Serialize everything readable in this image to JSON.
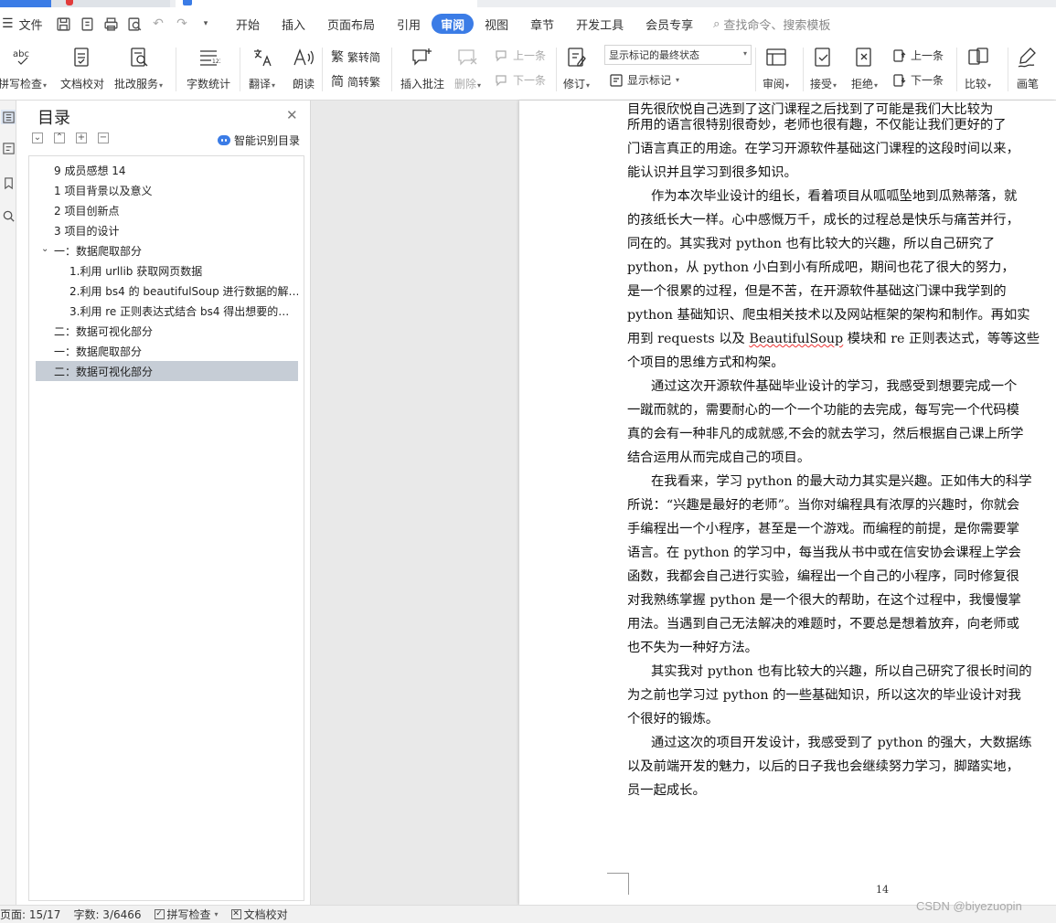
{
  "menu": {
    "file_label": "文件",
    "tabs": [
      "开始",
      "插入",
      "页面布局",
      "引用",
      "审阅",
      "视图",
      "章节",
      "开发工具",
      "会员专享"
    ],
    "active_tab": "审阅",
    "search_placeholder": "查找命令、搜索模板"
  },
  "ribbon": {
    "spell_check": "拼写检查",
    "doc_proofread": "文档校对",
    "revision_service": "批改服务",
    "word_count": "字数统计",
    "translate": "翻译",
    "read_aloud": "朗读",
    "trad_convert": "繁转简",
    "simp_convert": "简转繁",
    "insert_comment": "插入批注",
    "delete": "删除",
    "prev_comment": "上一条",
    "next_comment": "下一条",
    "track_changes": "修订",
    "markup_state": "显示标记的最终状态",
    "show_markup": "显示标记",
    "review_pane": "审阅",
    "accept": "接受",
    "reject": "拒绝",
    "prev_change": "上一条",
    "next_change": "下一条",
    "compare": "比较",
    "ink": "画笔"
  },
  "toc": {
    "title": "目录",
    "smart_label": "智能识别目录",
    "items": [
      {
        "text": "9   成员感想  14",
        "level": 1
      },
      {
        "text": "1   项目背景以及意义",
        "level": 1
      },
      {
        "text": "2   项目创新点",
        "level": 1
      },
      {
        "text": "3   项目的设计",
        "level": 1
      },
      {
        "text": "一：数据爬取部分",
        "level": 1,
        "expanded": true
      },
      {
        "text": "1.利用 urllib 获取网页数据",
        "level": 2
      },
      {
        "text": "2.利用 bs4 的 beautifulSoup 进行数据的解…",
        "level": 2
      },
      {
        "text": "3.利用 re 正则表达式结合 bs4 得出想要的…",
        "level": 2
      },
      {
        "text": "二：数据可视化部分",
        "level": 1
      },
      {
        "text": "一：数据爬取部分",
        "level": 1
      },
      {
        "text": "二：数据可视化部分",
        "level": 1,
        "selected": true
      }
    ]
  },
  "document": {
    "lines": [
      {
        "text": "目先很欣悦自己选到了这门课程之后找到了可能是我们大比较为",
        "indent": false,
        "first": true
      },
      {
        "text": "所用的语言很特别很奇妙，老师也很有趣，不仅能让我们更好的了",
        "indent": false
      },
      {
        "text": "门语言真正的用途。在学习开源软件基础这门课程的这段时间以来，",
        "indent": false
      },
      {
        "text": "能认识并且学习到很多知识。",
        "indent": false
      },
      {
        "text": "作为本次毕业设计的组长，看着项目从呱呱坠地到瓜熟蒂落，就",
        "indent": true
      },
      {
        "text": "的孩纸长大一样。心中感慨万千，成长的过程总是快乐与痛苦并行，",
        "indent": false
      },
      {
        "text": "同在的。其实我对 python 也有比较大的兴趣，所以自己研究了",
        "indent": false
      },
      {
        "text": "python，从 python 小白到小有所成吧，期间也花了很大的努力，",
        "indent": false
      },
      {
        "text": "是一个很累的过程，但是不苦，在开源软件基础这门课中我学到的",
        "indent": false
      },
      {
        "text": "python 基础知识、爬虫相关技术以及网站框架的架构和制作。再如实",
        "indent": false
      },
      {
        "text": "用到 requests 以及 BeautifulSoup 模块和 re 正则表达式，等等这些",
        "indent": false,
        "squiggle": "BeautifulSoup"
      },
      {
        "text": "个项目的思维方式和构架。",
        "indent": false
      },
      {
        "text": " 通过这次开源软件基础毕业设计的学习，我感受到想要完成一个",
        "indent": true
      },
      {
        "text": "一蹴而就的，需要耐心的一个一个功能的去完成，每写完一个代码模",
        "indent": false
      },
      {
        "text": "真的会有一种非凡的成就感,不会的就去学习，然后根据自己课上所学",
        "indent": false
      },
      {
        "text": "结合运用从而完成自己的项目。",
        "indent": false
      },
      {
        "text": "在我看来，学习 python 的最大动力其实是兴趣。正如伟大的科学",
        "indent": true
      },
      {
        "text": "所说：“兴趣是最好的老师”。当你对编程具有浓厚的兴趣时，你就会",
        "indent": false
      },
      {
        "text": "手编程出一个小程序，甚至是一个游戏。而编程的前提，是你需要掌",
        "indent": false
      },
      {
        "text": "语言。在 python 的学习中，每当我从书中或在信安协会课程上学会",
        "indent": false
      },
      {
        "text": "函数，我都会自己进行实验，编程出一个自己的小程序，同时修复很",
        "indent": false
      },
      {
        "text": "对我熟练掌握 python 是一个很大的帮助，在这个过程中，我慢慢掌",
        "indent": false
      },
      {
        "text": "用法。当遇到自己无法解决的难题时，不要总是想着放弃，向老师或",
        "indent": false
      },
      {
        "text": "也不失为一种好方法。",
        "indent": false
      },
      {
        "text": " 其实我对 python 也有比较大的兴趣，所以自己研究了很长时间的",
        "indent": true
      },
      {
        "text": "为之前也学习过 python 的一些基础知识，所以这次的毕业设计对我",
        "indent": false
      },
      {
        "text": "个很好的锻炼。",
        "indent": false
      },
      {
        "text": "通过这次的项目开发设计，我感受到了 python 的强大，大数据练",
        "indent": true
      },
      {
        "text": "以及前端开发的魅力，以后的日子我也会继续努力学习，脚踏实地，",
        "indent": false
      },
      {
        "text": "员一起成长。",
        "indent": false
      }
    ],
    "page_number": "14"
  },
  "status": {
    "page": "页面: 15/17",
    "words": "字数: 3/6466",
    "spell_check": "拼写检查",
    "proofread": "文档校对"
  },
  "watermark": "CSDN @biyezuopin"
}
